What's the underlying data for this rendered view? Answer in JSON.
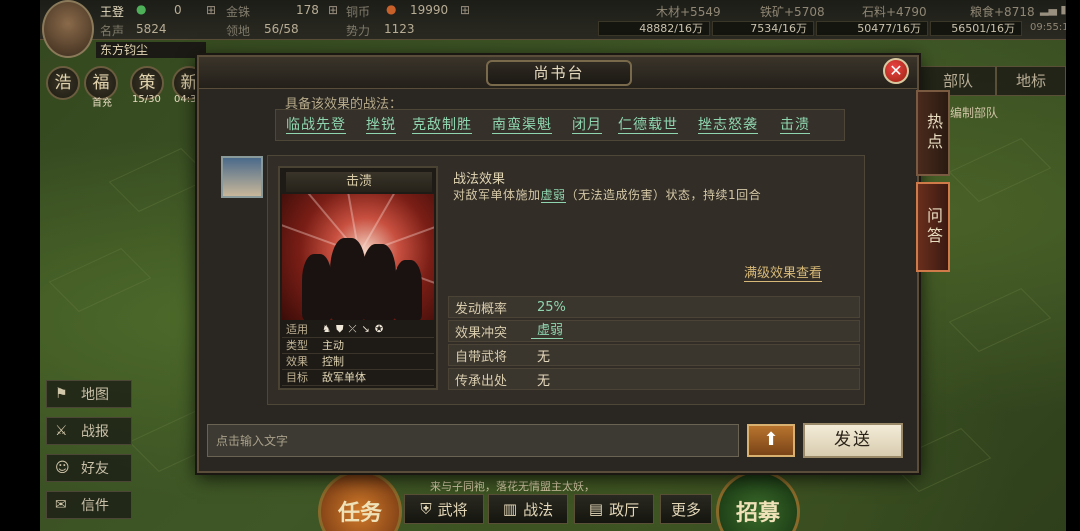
{
  "top": {
    "player_name": "王登",
    "jade": "0",
    "gold_label": "金铢",
    "gold": "178",
    "copper_label": "铜币",
    "copper": "19990",
    "fame_label": "名声",
    "fame": "5824",
    "land_label": "领地",
    "land": "56/58",
    "power_label": "势力",
    "power": "1123",
    "wood": "木材+5549",
    "wood_total": "48882/16万",
    "iron": "铁矿+5708",
    "iron_total": "7534/16万",
    "stone": "石料+4790",
    "stone_total": "50477/16万",
    "grain": "粮食+8718",
    "grain_total": "56501/16万",
    "time": "09:55:17",
    "nickname": "东方钧尘"
  },
  "stats": [
    {
      "char": "浩",
      "sub": ""
    },
    {
      "char": "福",
      "sub": "首充"
    },
    {
      "char": "策",
      "sub": "15/30"
    },
    {
      "char": "新",
      "sub": "04:33"
    }
  ],
  "side_menu": [
    {
      "icon": "map-icon",
      "glyph": "⚑",
      "label": "地图"
    },
    {
      "icon": "battle-report-icon",
      "glyph": "⚔",
      "label": "战报"
    },
    {
      "icon": "friends-icon",
      "glyph": "☺",
      "label": "好友"
    },
    {
      "icon": "mail-icon",
      "glyph": "✉",
      "label": "信件"
    }
  ],
  "bottom_bar": {
    "task": "任务",
    "generals": "武将",
    "tactics": "战法",
    "hall": "政厅",
    "more": "更多",
    "recruit": "招募",
    "news": "来与子同袍，落花无情盟主太妖，"
  },
  "right_tabs": {
    "troops": "部队",
    "marker": "地标",
    "formation": "编制部队"
  },
  "modal": {
    "title": "尚书台",
    "intro": "具备该效果的战法：",
    "tactics": [
      "临战先登",
      "挫锐",
      "克敌制胜",
      "南蛮渠魁",
      "闭月",
      "仁德载世",
      "挫志怒袭",
      "击溃"
    ],
    "card": {
      "name": "击溃",
      "rows": [
        {
          "k": "适用",
          "v": ""
        },
        {
          "k": "类型",
          "v": "主动"
        },
        {
          "k": "效果",
          "v": "控制"
        },
        {
          "k": "目标",
          "v": "敌军单体"
        }
      ],
      "unit_icons": [
        "cavalry-icon",
        "shield-icon",
        "bow-icon",
        "spear-icon",
        "siege-icon"
      ]
    },
    "effect_title": "战法效果",
    "effect_desc_pre": "对敌军单体施加",
    "effect_desc_hl": "虚弱",
    "effect_desc_post": "（无法造成伤害）状态，持续1回合",
    "max_level_link": "满级效果查看",
    "attrs": [
      {
        "k": "发动概率",
        "v": "25%"
      },
      {
        "k": "效果冲突",
        "v": "虚弱"
      },
      {
        "k": "自带武将",
        "v": "无"
      },
      {
        "k": "传承出处",
        "v": "无"
      }
    ],
    "input_placeholder": "点击输入文字",
    "send": "发送",
    "side_tabs": [
      "热点",
      "问答"
    ]
  },
  "colors": {
    "link_green": "#8fd6b0",
    "link_gold": "#d6b878",
    "close_red": "#c22"
  }
}
